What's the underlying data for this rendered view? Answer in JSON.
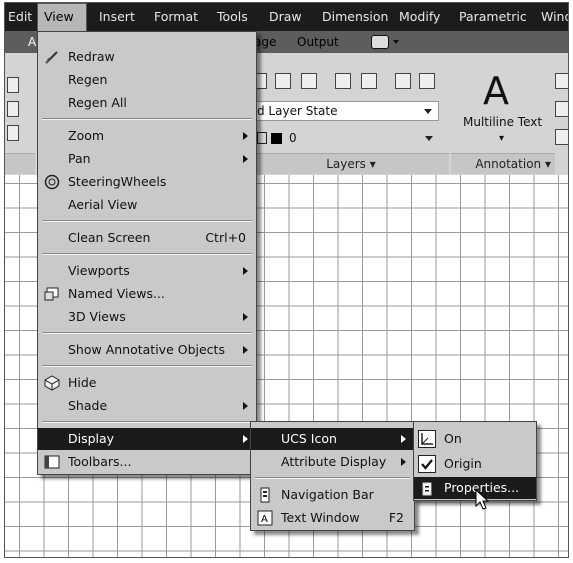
{
  "menubar": {
    "items": [
      "Edit",
      "View",
      "Insert",
      "Format",
      "Tools",
      "Draw",
      "Dimension",
      "Modify",
      "Parametric",
      "Wind"
    ],
    "active": "View"
  },
  "tabs": {
    "items": [
      "A",
      "age",
      "Output"
    ]
  },
  "ribbon": {
    "layer_state": "d Layer State",
    "layer_value": "0",
    "layers_title": "Layers",
    "annotation_title": "Annotation",
    "multiline_glyph": "A",
    "multiline_label": "Multiline Text"
  },
  "view_menu": {
    "redraw": "Redraw",
    "regen": "Regen",
    "regen_all": "Regen All",
    "zoom": "Zoom",
    "pan": "Pan",
    "steeringwheels": "SteeringWheels",
    "aerial_view": "Aerial View",
    "clean_screen": "Clean Screen",
    "clean_screen_shortcut": "Ctrl+0",
    "viewports": "Viewports",
    "named_views": "Named Views...",
    "views_3d": "3D Views",
    "show_annotative": "Show Annotative Objects",
    "hide": "Hide",
    "shade": "Shade",
    "display": "Display",
    "toolbars": "Toolbars..."
  },
  "display_menu": {
    "ucs_icon": "UCS Icon",
    "attribute_display": "Attribute Display",
    "navigation_bar": "Navigation Bar",
    "text_window": "Text Window",
    "text_window_shortcut": "F2"
  },
  "ucs_menu": {
    "on": "On",
    "origin": "Origin",
    "properties": "Properties..."
  },
  "colors": {
    "menubar_bg": "#1c1c1c",
    "menu_bg": "#c9c9c9",
    "highlight_bg": "#1b1b1b",
    "ribbon_bg": "#d4d4d4",
    "grid_line": "#9a9a9a"
  }
}
